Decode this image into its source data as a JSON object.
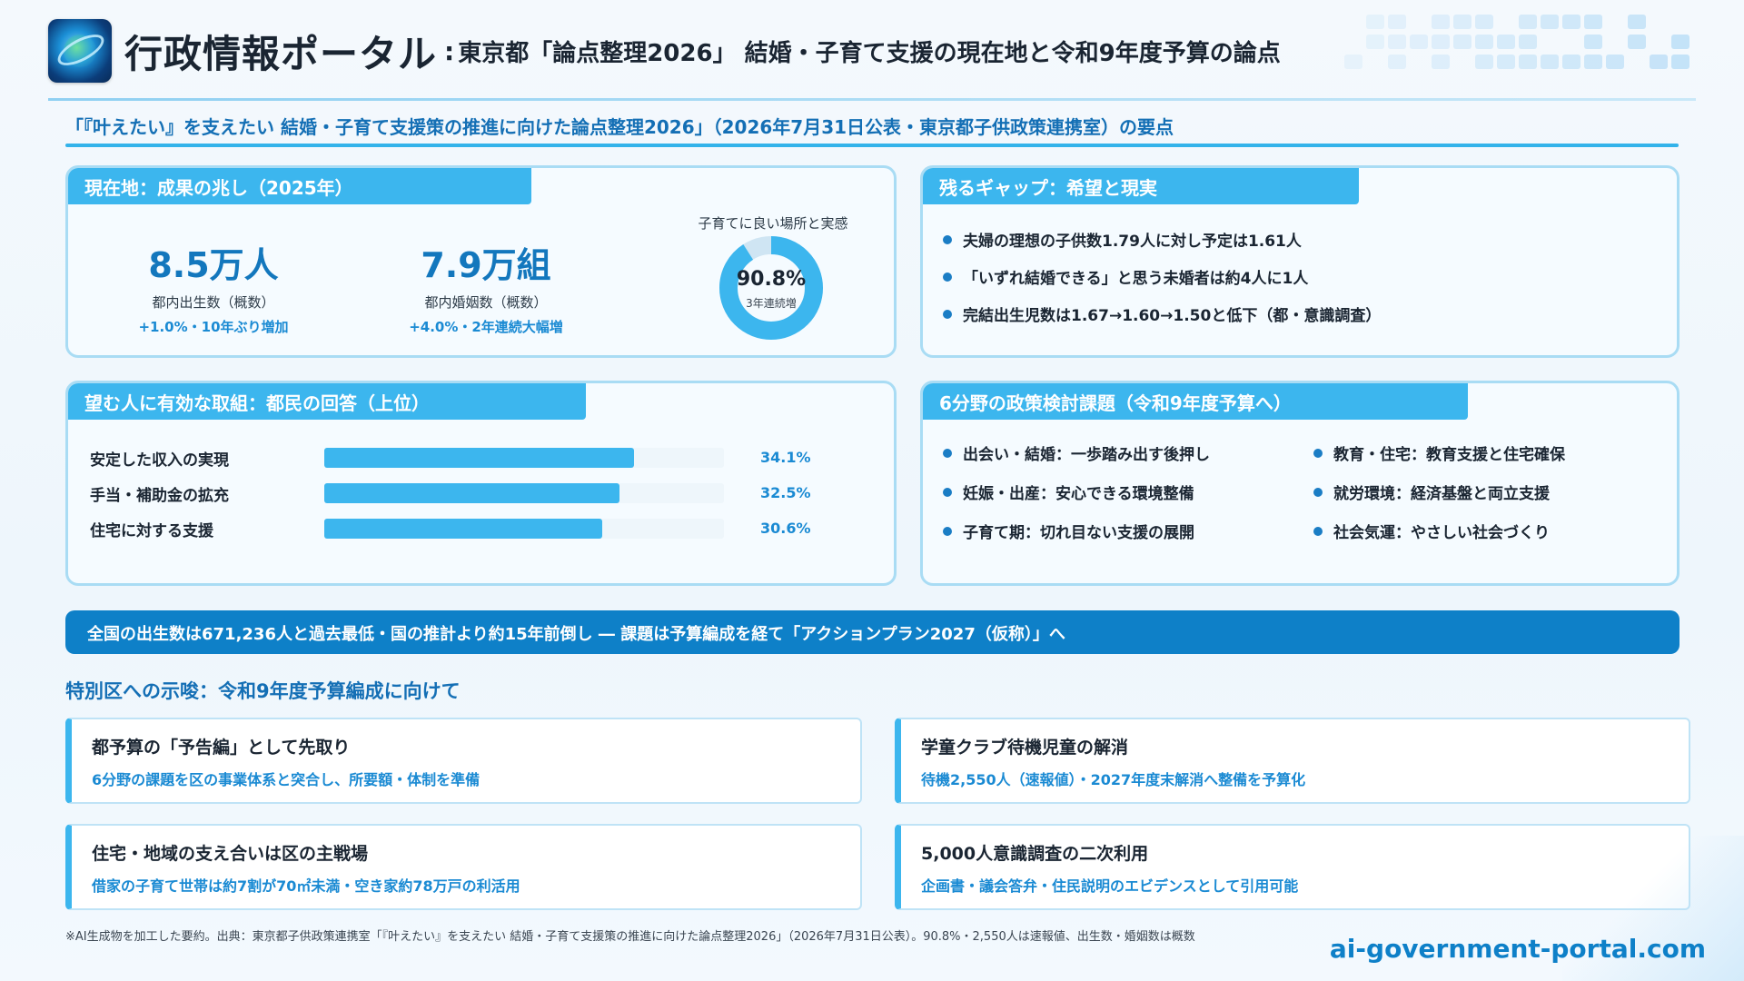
{
  "header": {
    "brand": "行政情報ポータル",
    "separator": ":",
    "title": "東京都「論点整理2026」 結婚・子育て支援の現在地と令和9年度予算の論点"
  },
  "summary": "「『叶えたい』を支えたい 結婚・子育て支援策の推進に向けた論点整理2026」（2026年7月31日公表・東京都子供政策連携室）の要点",
  "current": {
    "tab": "現在地：成果の兆し（2025年）",
    "stats": [
      {
        "value": "8.5万人",
        "label": "都内出生数（概数）",
        "change": "+1.0%・10年ぶり増加"
      },
      {
        "value": "7.9万組",
        "label": "都内婚姻数（概数）",
        "change": "+4.0%・2年連続大幅増"
      }
    ],
    "donut": {
      "label": "子育てに良い場所と実感",
      "value_text": "90.8%",
      "value": 90.8,
      "note": "3年連続増",
      "color": "#3cb6ee",
      "track_color": "#cfe5f3"
    }
  },
  "gap": {
    "tab": "残るギャップ：希望と現実",
    "items": [
      "夫婦の理想の子供数1.79人に対し予定は1.61人",
      "「いずれ結婚できる」と思う未婚者は約4人に1人",
      "完結出生児数は1.67→1.60→1.50と低下（都・意識調査）"
    ]
  },
  "effective": {
    "tab": "望む人に有効な取組：都民の回答（上位）",
    "bar_max": 44,
    "rows": [
      {
        "label": "安定した収入の実現",
        "value": 34.1,
        "text": "34.1%"
      },
      {
        "label": "手当・補助金の拡充",
        "value": 32.5,
        "text": "32.5%"
      },
      {
        "label": "住宅に対する支援",
        "value": 30.6,
        "text": "30.6%"
      }
    ]
  },
  "six": {
    "tab": "6分野の政策検討課題（令和9年度予算へ）",
    "left": [
      "出会い・結婚：一歩踏み出す後押し",
      "妊娠・出産：安心できる環境整備",
      "子育て期：切れ目ない支援の展開"
    ],
    "right": [
      "教育・住宅：教育支援と住宅確保",
      "就労環境：経済基盤と両立支援",
      "社会気運：やさしい社会づくり"
    ]
  },
  "banner": "全国の出生数は671,236人と過去最低・国の推計より約15年前倒し ― 課題は予算編成を経て「アクションプラン2027（仮称）」へ",
  "implications": {
    "title": "特別区への示唆：令和9年度予算編成に向けて",
    "cards": [
      {
        "heading": "都予算の「予告編」として先取り",
        "detail": "6分野の課題を区の事業体系と突合し、所要額・体制を準備"
      },
      {
        "heading": "学童クラブ待機児童の解消",
        "detail": "待機2,550人（速報値）・2027年度末解消へ整備を予算化"
      },
      {
        "heading": "住宅・地域の支え合いは区の主戦場",
        "detail": "借家の子育て世帯は約7割が70㎡未満・空き家約78万戸の利活用"
      },
      {
        "heading": "5,000人意識調査の二次利用",
        "detail": "企画書・議会答弁・住民説明のエビデンスとして引用可能"
      }
    ]
  },
  "footnote": "※AI生成物を加工した要約。出典：東京都子供政策連携室「『叶えたい』を支えたい 結婚・子育て支援策の推進に向けた論点整理2026」（2026年7月31日公表）。90.8%・2,550人は速報値、出生数・婚姻数は概数",
  "site": "ai-government-portal.com"
}
